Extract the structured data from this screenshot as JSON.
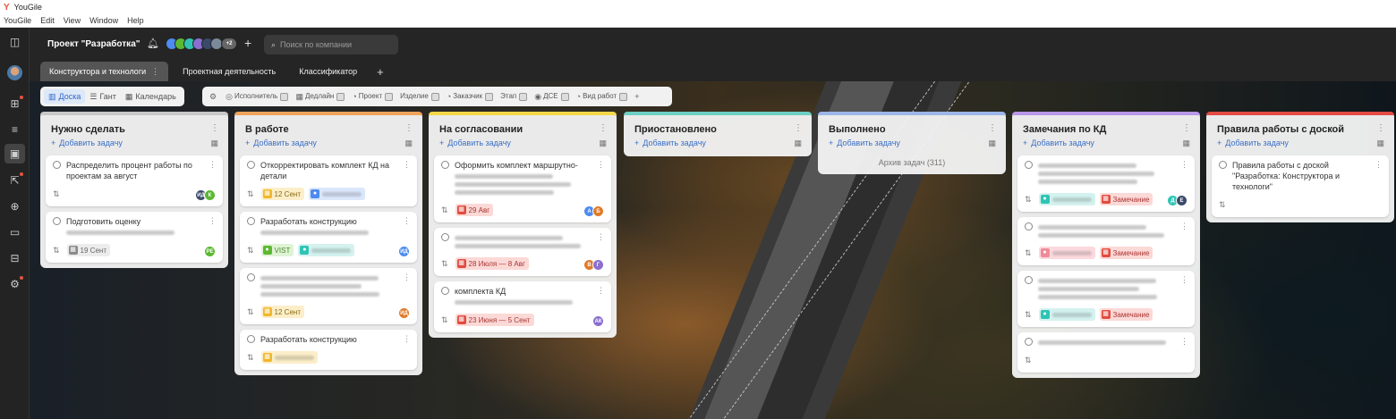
{
  "app": {
    "title": "YouGile",
    "menu": [
      "YouGile",
      "Edit",
      "View",
      "Window",
      "Help"
    ]
  },
  "header": {
    "project": "Проект \"Разработка\"",
    "members_more": "+2",
    "search_placeholder": "Поиск по компании"
  },
  "tabs": [
    {
      "label": "Конструктора и технологи",
      "active": true
    },
    {
      "label": "Проектная деятельность"
    },
    {
      "label": "Классификатор"
    }
  ],
  "views": [
    {
      "label": "Доска",
      "active": true
    },
    {
      "label": "Гант"
    },
    {
      "label": "Календарь"
    }
  ],
  "filters": [
    "Исполнитель",
    "Дедлайн",
    "Проект",
    "Изделие",
    "Заказчик",
    "Этап",
    "ДСЕ",
    "Вид работ"
  ],
  "columns": [
    {
      "title": "Нужно сделать",
      "color": "#c8c8c8",
      "add": "Добавить задачу",
      "cards": [
        {
          "text": "Распределить процент работы по проектам за август",
          "avatars": [
            "ИД",
            "К"
          ]
        },
        {
          "text": "Подготовить оценку",
          "blur": 1,
          "tags": [
            {
              "style": "grey",
              "text": "19 Сент"
            }
          ],
          "avatars": [
            "РЕ"
          ]
        }
      ]
    },
    {
      "title": "В работе",
      "color": "#f0a35a",
      "add": "Добавить задачу",
      "cards": [
        {
          "text": "Откорректировать комплект КД на детали",
          "tags": [
            {
              "style": "yellow",
              "text": "12 Сент"
            },
            {
              "style": "blue",
              "text": ""
            }
          ]
        },
        {
          "text": "Разработать конструкцию",
          "blur": 1,
          "tags": [
            {
              "style": "green",
              "text": "VIST"
            },
            {
              "style": "teal",
              "text": ""
            }
          ],
          "avatars": [
            "ИД"
          ]
        },
        {
          "text": "",
          "blur": 3,
          "tags": [
            {
              "style": "yellow",
              "text": "12 Сент"
            }
          ],
          "avatars": [
            "ИД"
          ]
        },
        {
          "text": "Разработать конструкцию",
          "tags": [
            {
              "style": "yellow",
              "text": ""
            }
          ]
        }
      ]
    },
    {
      "title": "На согласовании",
      "color": "#f3d94a",
      "add": "Добавить задачу",
      "cards": [
        {
          "text": "Оформить комплект маршрутно-",
          "blur": 3,
          "tags": [
            {
              "style": "red",
              "text": "29 Авг"
            }
          ],
          "avatars": [
            "А",
            "Б"
          ]
        },
        {
          "text": "",
          "blur": 2,
          "tags": [
            {
              "style": "red",
              "text": "28 Июля — 8 Авг"
            }
          ],
          "avatars": [
            "В",
            "Г"
          ]
        },
        {
          "text": "комплекта КД",
          "blur": 1,
          "tags": [
            {
              "style": "red",
              "text": "23 Июня — 5 Сент"
            }
          ],
          "avatars": [
            "АК"
          ]
        }
      ]
    },
    {
      "title": "Приостановлено",
      "color": "#6ccfc4",
      "add": "Добавить задачу",
      "cards": []
    },
    {
      "title": "Выполнено",
      "color": "#9cb6e8",
      "add": "Добавить задачу",
      "archive": "Архив задач (311)",
      "cards": []
    },
    {
      "title": "Замечания по КД",
      "color": "#b896e8",
      "add": "Добавить задачу",
      "cards": [
        {
          "text": "",
          "blur": 3,
          "tags": [
            {
              "style": "teal",
              "text": ""
            },
            {
              "style": "red",
              "text": "Замечание"
            }
          ],
          "avatars": [
            "Д",
            "Е"
          ]
        },
        {
          "text": "",
          "blur": 2,
          "tags": [
            {
              "style": "pink",
              "text": ""
            },
            {
              "style": "red",
              "text": "Замечание"
            }
          ]
        },
        {
          "text": "",
          "blur": 3,
          "tags": [
            {
              "style": "teal",
              "text": ""
            },
            {
              "style": "red",
              "text": "Замечание"
            }
          ]
        },
        {
          "text": "",
          "blur": 1
        }
      ]
    },
    {
      "title": "Правила работы с доской",
      "color": "#e34b45",
      "add": "Добавить задачу",
      "cards": [
        {
          "text": "Правила работы с доской \"Разработка: Конструктора и технологи\""
        }
      ]
    }
  ]
}
